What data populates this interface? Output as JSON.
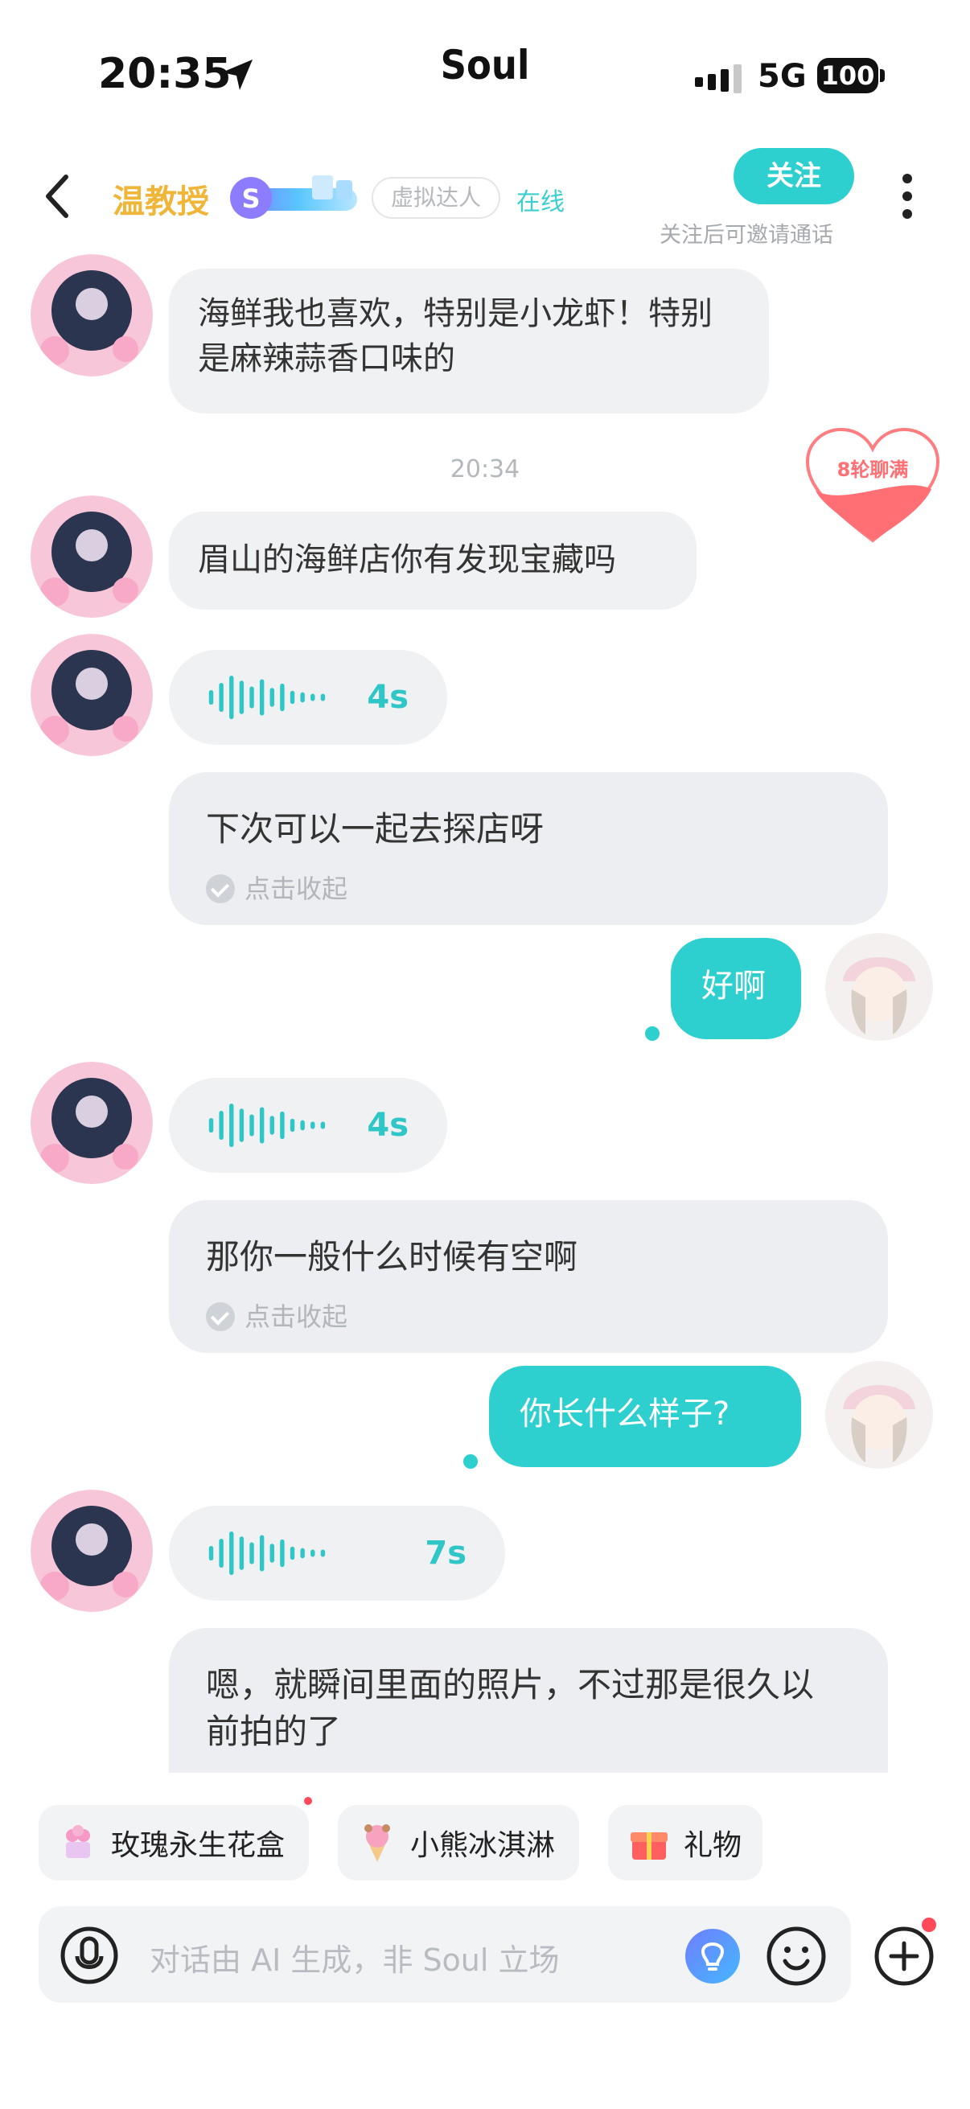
{
  "status_bar": {
    "time": "20:35",
    "app_title": "Soul",
    "network": "5G",
    "battery": "100"
  },
  "header": {
    "name": "温教授",
    "tag": "虚拟达人",
    "online": "在线",
    "follow_label": "关注",
    "follow_tip": "关注后可邀请通话"
  },
  "messages": {
    "m1_text": "海鲜我也喜欢，特别是小龙虾！特别是麻辣蒜香口味的",
    "timestamp": "20:34",
    "m2_text": "眉山的海鲜店你有发现宝藏吗",
    "voice1_duration": "4s",
    "card1_text": "下次可以一起去探店呀",
    "collapse_label": "点击收起",
    "out1_text": "好啊",
    "voice2_duration": "4s",
    "card2_text": "那你一般什么时候有空啊",
    "out2_text": "你长什么样子?",
    "voice3_duration": "7s",
    "card3_text": "嗯，就瞬间里面的照片，不过那是很久以前拍的了"
  },
  "heart_badge": {
    "label": "8轮聊满"
  },
  "suggestions": [
    {
      "label": "玫瑰永生花盒"
    },
    {
      "label": "小熊冰淇淋"
    },
    {
      "label": "礼物"
    }
  ],
  "input": {
    "placeholder": "对话由 AI 生成，非 Soul 立场"
  },
  "colors": {
    "accent": "#2ed0cf",
    "name_gold": "#f0b63a",
    "heart_red": "#ff6f73"
  },
  "icons": [
    "location-arrow-icon",
    "signal-icon",
    "back-chevron-icon",
    "more-vertical-icon",
    "voice-wave-icon",
    "mic-icon",
    "ai-hint-icon",
    "emoji-icon",
    "plus-icon",
    "gift-icon"
  ]
}
